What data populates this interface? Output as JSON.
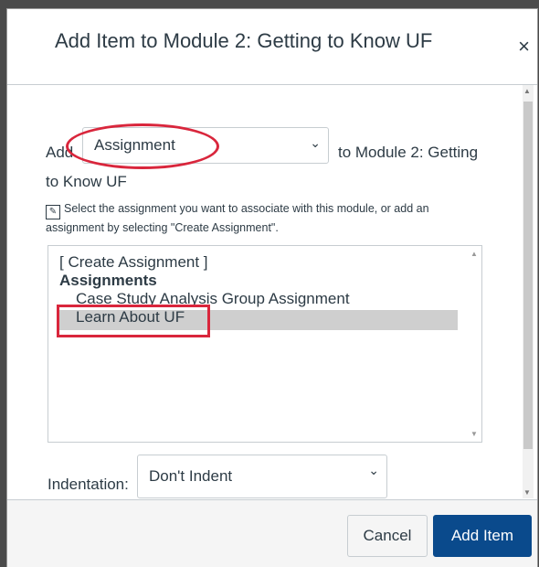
{
  "dialog": {
    "title": "Add Item to Module 2: Getting to Know UF",
    "close_label": "×"
  },
  "add_row": {
    "prefix": "Add",
    "selected_type": "Assignment",
    "suffix": "to Module 2: Getting",
    "suffix_wrap": "to Know UF"
  },
  "hint": {
    "text": "Select the assignment you want to associate with this module, or add an assignment by selecting \"Create Assignment\"."
  },
  "listbox": {
    "create_option": "[ Create Assignment ]",
    "group_label": "Assignments",
    "items": [
      "Case Study Analysis Group Assignment",
      "Learn About UF"
    ],
    "selected_item": "Learn About UF"
  },
  "indentation": {
    "label": "Indentation:",
    "selected": "Don't Indent"
  },
  "footer": {
    "cancel_label": "Cancel",
    "submit_label": "Add Item"
  },
  "colors": {
    "primary": "#0a4a8c",
    "highlight": "#d9263c",
    "text": "#2d3b45"
  }
}
